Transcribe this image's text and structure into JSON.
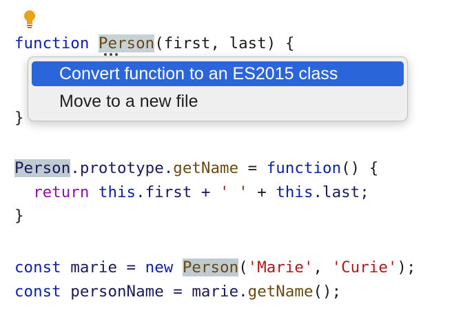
{
  "code": {
    "line1": {
      "kw": "function",
      "name": "Person",
      "args": "(first, last) {"
    },
    "line2": {
      "brace": "}"
    },
    "line3": {
      "name": "Person",
      "mid": ".prototype.",
      "method": "getName",
      "eq": " = ",
      "kw": "function",
      "tail": "() {"
    },
    "line4": {
      "kw": "return",
      "this1": "this",
      "p1": ".first + ",
      "str": "' '",
      "p2": " + ",
      "this2": "this",
      "p3": ".last;"
    },
    "line5": {
      "brace": "}"
    },
    "line6": {
      "kw": "const",
      "var": " marie = ",
      "kw_new": "new",
      "name": "Person",
      "open": "(",
      "s1": "'Marie'",
      "comma": ", ",
      "s2": "'Curie'",
      "close": ");"
    },
    "line7": {
      "kw": "const",
      "var": " personName = marie.",
      "method": "getName",
      "tail": "();"
    }
  },
  "context_menu": {
    "items": [
      {
        "label": "Convert function to an ES2015 class",
        "selected": true
      },
      {
        "label": "Move to a new file",
        "selected": false
      }
    ]
  },
  "icons": {
    "intention": "lightbulb-icon"
  },
  "colors": {
    "selection": "#2a66d9",
    "bulb": "#e8a317",
    "highlight": "#c6d2d6"
  }
}
